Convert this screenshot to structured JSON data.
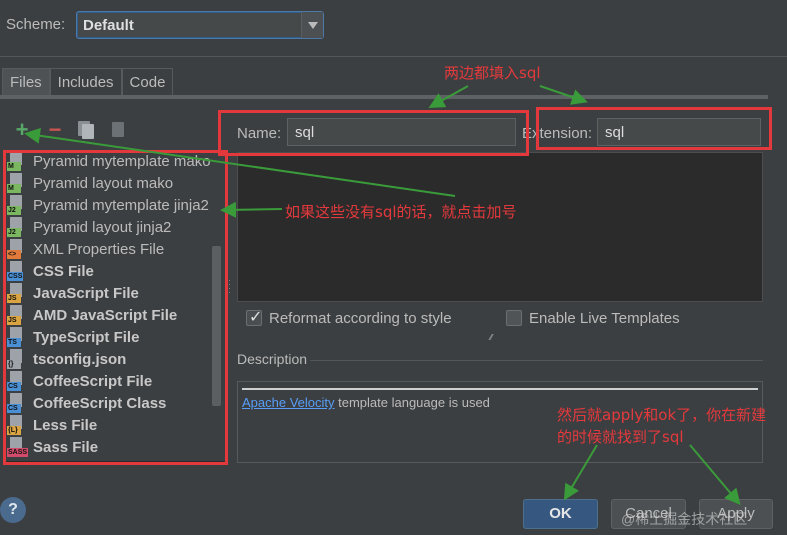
{
  "scheme": {
    "label": "Scheme:",
    "value": "Default"
  },
  "tabs": [
    {
      "label": "Files",
      "active": true
    },
    {
      "label": "Includes",
      "active": false
    },
    {
      "label": "Code",
      "active": false
    }
  ],
  "toolbar": {
    "add": "+",
    "remove": "−"
  },
  "file_list": [
    {
      "label": "Pyramid mytemplate mako",
      "tag": "M",
      "tag_color": "#7bb661",
      "bold": false
    },
    {
      "label": "Pyramid layout mako",
      "tag": "M",
      "tag_color": "#7bb661",
      "bold": false
    },
    {
      "label": "Pyramid mytemplate jinja2",
      "tag": "J2",
      "tag_color": "#7bb661",
      "bold": false
    },
    {
      "label": "Pyramid layout jinja2",
      "tag": "J2",
      "tag_color": "#7bb661",
      "bold": false
    },
    {
      "label": "XML Properties File",
      "tag": "<>",
      "tag_color": "#e07a3a",
      "bold": false
    },
    {
      "label": "CSS File",
      "tag": "CSS",
      "tag_color": "#4a8fd4",
      "bold": true
    },
    {
      "label": "JavaScript File",
      "tag": "JS",
      "tag_color": "#d9a441",
      "bold": true
    },
    {
      "label": "AMD JavaScript File",
      "tag": "JS",
      "tag_color": "#d9a441",
      "bold": true
    },
    {
      "label": "TypeScript File",
      "tag": "TS",
      "tag_color": "#4a8fd4",
      "bold": true
    },
    {
      "label": "tsconfig.json",
      "tag": "{}",
      "tag_color": "#9da3a8",
      "bold": true
    },
    {
      "label": "CoffeeScript File",
      "tag": "CS",
      "tag_color": "#4a8fd4",
      "bold": true
    },
    {
      "label": "CoffeeScript Class",
      "tag": "CS",
      "tag_color": "#4a8fd4",
      "bold": true
    },
    {
      "label": "Less File",
      "tag": "{L}",
      "tag_color": "#d9a441",
      "bold": true
    },
    {
      "label": "Sass File",
      "tag": "SASS",
      "tag_color": "#d24b6a",
      "bold": true
    }
  ],
  "form": {
    "name_label": "Name:",
    "name_value": "sql",
    "extension_label": "Extension:",
    "extension_value": "sql"
  },
  "options": {
    "reformat_label": "Reformat according to style",
    "reformat_checked": true,
    "live_templates_label": "Enable Live Templates",
    "live_templates_checked": false
  },
  "description": {
    "label": "Description",
    "link": "Apache Velocity",
    "text": " template language is used"
  },
  "buttons": {
    "help": "?",
    "ok": "OK",
    "cancel": "Cancel",
    "apply": "Apply"
  },
  "annotations": {
    "note_top": "两边都填入sql",
    "note_middle": "如果这些没有sql的话，就点击加号",
    "note_bottom_1": "然后就apply和ok了，你在新建",
    "note_bottom_2": "的时候就找到了sql",
    "color": "#e4393c",
    "arrow_color": "#3a9b3a"
  },
  "watermark": "@稀土掘金技术社区"
}
